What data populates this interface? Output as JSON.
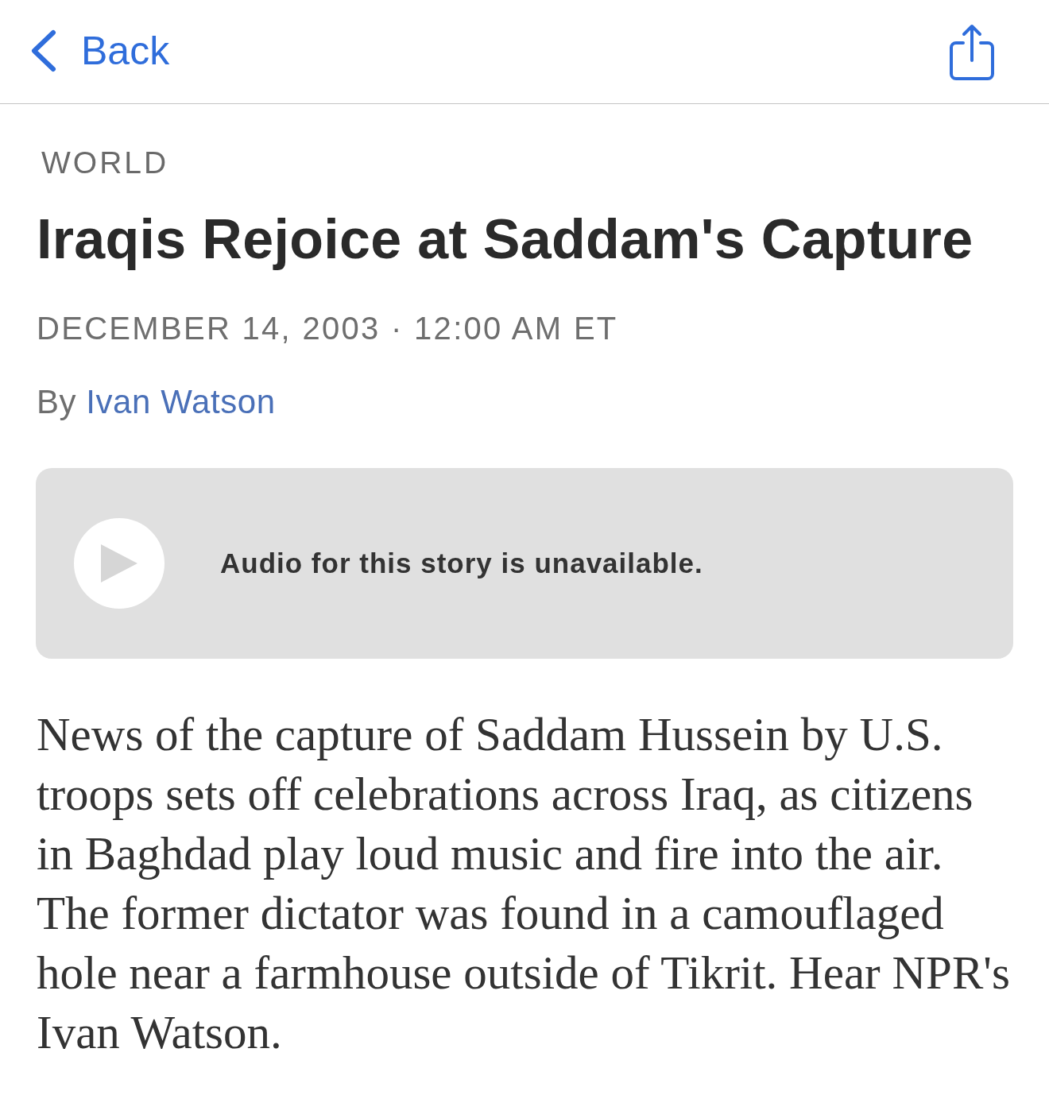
{
  "nav": {
    "back_label": "Back"
  },
  "article": {
    "section": "WORLD",
    "title": "Iraqis Rejoice at Saddam's Capture",
    "dateline": "DECEMBER 14, 2003 · 12:00 AM ET",
    "byline": {
      "prefix": "By",
      "author": "Ivan Watson"
    },
    "audio": {
      "playable": false,
      "message": "Audio for this story is unavailable."
    },
    "body": "News of the capture of Saddam Hussein by U.S. troops sets off celebrations across Iraq, as citizens in Baghdad play loud music and fire into the air. The former dictator was found in a camouflaged hole near a farmhouse outside of Tikrit. Hear NPR's Ivan Watson."
  }
}
